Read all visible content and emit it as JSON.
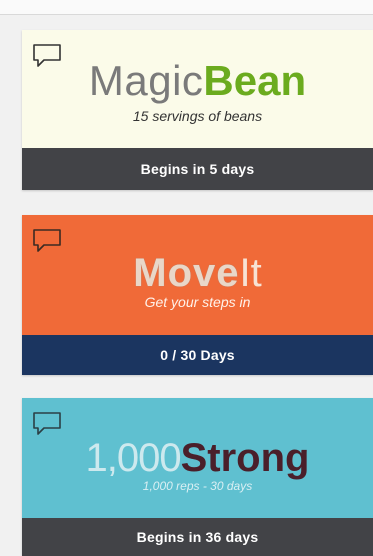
{
  "colors": {
    "page_background": "#f1f1f1",
    "magicbean_background": "#fbfbe9",
    "magicbean_brand_bold": "#6bab1e",
    "moveit_background": "#f06a38",
    "moveit_footer": "#1b3560",
    "strong_background": "#5fc0d0",
    "strong_bold": "#4a1f2a",
    "footer_gray": "#424347"
  },
  "challenges": [
    {
      "icon": "comment-icon",
      "title_light": "Magic",
      "title_bold": "Bean",
      "subtitle": "15 servings of beans",
      "footer": "Begins in 5 days"
    },
    {
      "icon": "comment-icon",
      "title_bold": "Move",
      "title_light": "It",
      "subtitle": "Get your steps in",
      "footer": "0 / 30 Days"
    },
    {
      "icon": "comment-icon",
      "title_light": "1,000",
      "title_bold": "Strong",
      "subtitle": "1,000 reps - 30 days",
      "footer": "Begins in 36 days"
    }
  ]
}
